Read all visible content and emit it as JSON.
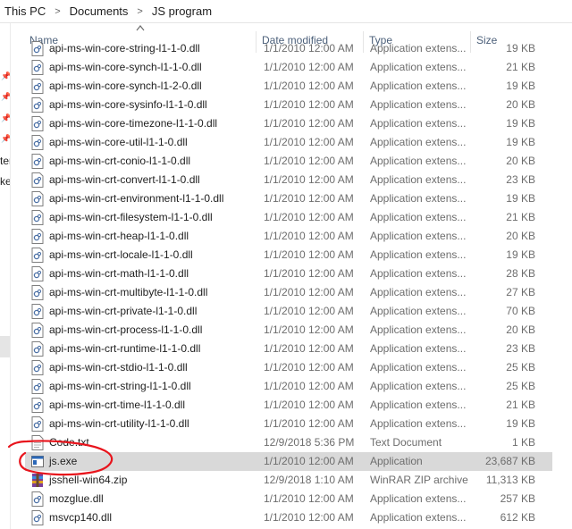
{
  "breadcrumb": [
    "This PC",
    "Documents",
    "JS program"
  ],
  "breadcrumb_separator": ">",
  "nav": {
    "text1": "ter",
    "text2": "ke"
  },
  "columns": {
    "name": "Name",
    "date": "Date modified",
    "type": "Type",
    "size": "Size"
  },
  "files": [
    {
      "name": "api-ms-win-core-string-l1-1-0.dll",
      "date": "1/1/2010 12:00 AM",
      "type": "Application extens...",
      "size": "19 KB",
      "icon": "dll-icon"
    },
    {
      "name": "api-ms-win-core-synch-l1-1-0.dll",
      "date": "1/1/2010 12:00 AM",
      "type": "Application extens...",
      "size": "21 KB",
      "icon": "dll-icon"
    },
    {
      "name": "api-ms-win-core-synch-l1-2-0.dll",
      "date": "1/1/2010 12:00 AM",
      "type": "Application extens...",
      "size": "19 KB",
      "icon": "dll-icon"
    },
    {
      "name": "api-ms-win-core-sysinfo-l1-1-0.dll",
      "date": "1/1/2010 12:00 AM",
      "type": "Application extens...",
      "size": "20 KB",
      "icon": "dll-icon"
    },
    {
      "name": "api-ms-win-core-timezone-l1-1-0.dll",
      "date": "1/1/2010 12:00 AM",
      "type": "Application extens...",
      "size": "19 KB",
      "icon": "dll-icon"
    },
    {
      "name": "api-ms-win-core-util-l1-1-0.dll",
      "date": "1/1/2010 12:00 AM",
      "type": "Application extens...",
      "size": "19 KB",
      "icon": "dll-icon"
    },
    {
      "name": "api-ms-win-crt-conio-l1-1-0.dll",
      "date": "1/1/2010 12:00 AM",
      "type": "Application extens...",
      "size": "20 KB",
      "icon": "dll-icon"
    },
    {
      "name": "api-ms-win-crt-convert-l1-1-0.dll",
      "date": "1/1/2010 12:00 AM",
      "type": "Application extens...",
      "size": "23 KB",
      "icon": "dll-icon"
    },
    {
      "name": "api-ms-win-crt-environment-l1-1-0.dll",
      "date": "1/1/2010 12:00 AM",
      "type": "Application extens...",
      "size": "19 KB",
      "icon": "dll-icon"
    },
    {
      "name": "api-ms-win-crt-filesystem-l1-1-0.dll",
      "date": "1/1/2010 12:00 AM",
      "type": "Application extens...",
      "size": "21 KB",
      "icon": "dll-icon"
    },
    {
      "name": "api-ms-win-crt-heap-l1-1-0.dll",
      "date": "1/1/2010 12:00 AM",
      "type": "Application extens...",
      "size": "20 KB",
      "icon": "dll-icon"
    },
    {
      "name": "api-ms-win-crt-locale-l1-1-0.dll",
      "date": "1/1/2010 12:00 AM",
      "type": "Application extens...",
      "size": "19 KB",
      "icon": "dll-icon"
    },
    {
      "name": "api-ms-win-crt-math-l1-1-0.dll",
      "date": "1/1/2010 12:00 AM",
      "type": "Application extens...",
      "size": "28 KB",
      "icon": "dll-icon"
    },
    {
      "name": "api-ms-win-crt-multibyte-l1-1-0.dll",
      "date": "1/1/2010 12:00 AM",
      "type": "Application extens...",
      "size": "27 KB",
      "icon": "dll-icon"
    },
    {
      "name": "api-ms-win-crt-private-l1-1-0.dll",
      "date": "1/1/2010 12:00 AM",
      "type": "Application extens...",
      "size": "70 KB",
      "icon": "dll-icon"
    },
    {
      "name": "api-ms-win-crt-process-l1-1-0.dll",
      "date": "1/1/2010 12:00 AM",
      "type": "Application extens...",
      "size": "20 KB",
      "icon": "dll-icon"
    },
    {
      "name": "api-ms-win-crt-runtime-l1-1-0.dll",
      "date": "1/1/2010 12:00 AM",
      "type": "Application extens...",
      "size": "23 KB",
      "icon": "dll-icon"
    },
    {
      "name": "api-ms-win-crt-stdio-l1-1-0.dll",
      "date": "1/1/2010 12:00 AM",
      "type": "Application extens...",
      "size": "25 KB",
      "icon": "dll-icon"
    },
    {
      "name": "api-ms-win-crt-string-l1-1-0.dll",
      "date": "1/1/2010 12:00 AM",
      "type": "Application extens...",
      "size": "25 KB",
      "icon": "dll-icon"
    },
    {
      "name": "api-ms-win-crt-time-l1-1-0.dll",
      "date": "1/1/2010 12:00 AM",
      "type": "Application extens...",
      "size": "21 KB",
      "icon": "dll-icon"
    },
    {
      "name": "api-ms-win-crt-utility-l1-1-0.dll",
      "date": "1/1/2010 12:00 AM",
      "type": "Application extens...",
      "size": "19 KB",
      "icon": "dll-icon"
    },
    {
      "name": "Code.txt",
      "date": "12/9/2018 5:36 PM",
      "type": "Text Document",
      "size": "1 KB",
      "icon": "text-file-icon"
    },
    {
      "name": "js.exe",
      "date": "1/1/2010 12:00 AM",
      "type": "Application",
      "size": "23,687 KB",
      "icon": "exe-icon",
      "selected": true
    },
    {
      "name": "jsshell-win64.zip",
      "date": "12/9/2018 1:10 AM",
      "type": "WinRAR ZIP archive",
      "size": "11,313 KB",
      "icon": "winrar-icon"
    },
    {
      "name": "mozglue.dll",
      "date": "1/1/2010 12:00 AM",
      "type": "Application extens...",
      "size": "257 KB",
      "icon": "dll-icon"
    },
    {
      "name": "msvcp140.dll",
      "date": "1/1/2010 12:00 AM",
      "type": "Application extens...",
      "size": "612 KB",
      "icon": "dll-icon"
    }
  ],
  "colors": {
    "header_text": "#4c607a",
    "selected_row": "#d9d9d9",
    "annotation": "#e8141c",
    "secondary_text": "#6d6d6d"
  }
}
